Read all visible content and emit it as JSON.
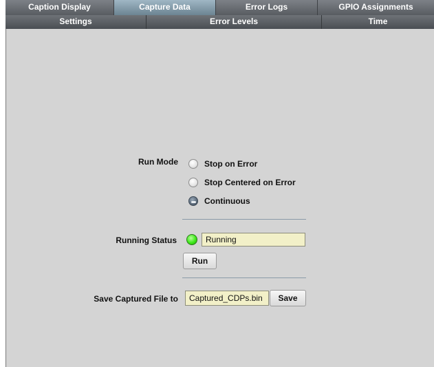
{
  "tabs": {
    "row1": [
      {
        "label": "Caption Display",
        "active": false
      },
      {
        "label": "Capture Data",
        "active": true
      },
      {
        "label": "Error Logs",
        "active": false
      },
      {
        "label": "GPIO Assignments",
        "active": false
      }
    ],
    "row2": [
      {
        "label": "Settings"
      },
      {
        "label": "Error Levels"
      },
      {
        "label": "Time"
      }
    ]
  },
  "run_mode": {
    "label": "Run Mode",
    "options": [
      {
        "label": "Stop on Error",
        "selected": false
      },
      {
        "label": "Stop Centered on Error",
        "selected": false
      },
      {
        "label": "Continuous",
        "selected": true
      }
    ]
  },
  "running_status": {
    "label": "Running Status",
    "value": "Running",
    "indicator_color": "#3ee81a"
  },
  "run_button": {
    "label": "Run"
  },
  "save_file": {
    "label": "Save Captured File to",
    "filename": "Captured_CDPs.bin",
    "button_label": "Save"
  },
  "colors": {
    "panel_background": "#d4d4d4",
    "tab_background": "#5c6065",
    "active_tab": "#8ca4b2",
    "textbox_background": "#f2f0c8"
  }
}
